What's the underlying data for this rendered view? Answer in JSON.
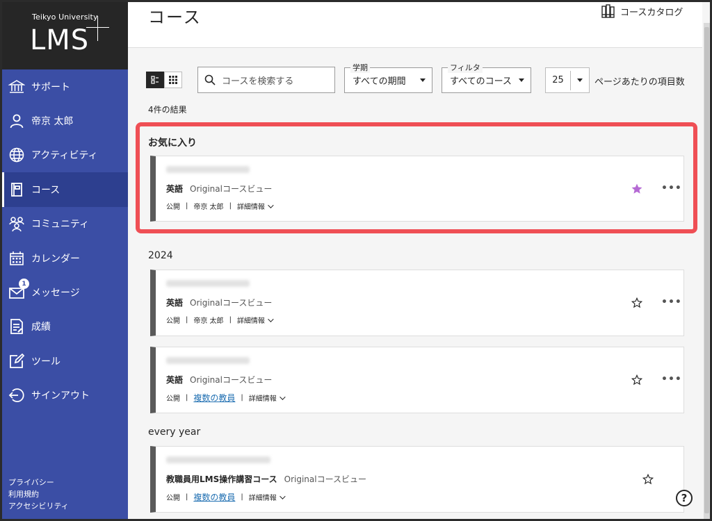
{
  "logo": {
    "university": "Teikyo University",
    "system": "LMS"
  },
  "sidebar": {
    "items": [
      {
        "label": "サポート",
        "icon": "institution-icon"
      },
      {
        "label": "帝京 太郎",
        "icon": "user-icon"
      },
      {
        "label": "アクティビティ",
        "icon": "globe-icon"
      },
      {
        "label": "コース",
        "icon": "book-icon",
        "active": true
      },
      {
        "label": "コミュニティ",
        "icon": "community-icon"
      },
      {
        "label": "カレンダー",
        "icon": "calendar-icon"
      },
      {
        "label": "メッセージ",
        "icon": "envelope-icon",
        "badge": "1"
      },
      {
        "label": "成績",
        "icon": "grades-icon"
      },
      {
        "label": "ツール",
        "icon": "tools-icon"
      },
      {
        "label": "サインアウト",
        "icon": "sign-out-icon"
      }
    ],
    "footer": [
      "プライバシー",
      "利用規約",
      "アクセシビリティ"
    ]
  },
  "header": {
    "title": "コース",
    "catalog_label": "コースカタログ"
  },
  "toolbar": {
    "search_placeholder": "コースを検索する",
    "term_label": "学期",
    "term_value": "すべての期間",
    "filter_label": "フィルタ",
    "filter_value": "すべてのコース",
    "per_page": "25",
    "per_page_label": "ページあたりの項目数"
  },
  "result_count": "4件の結果",
  "sections": [
    {
      "title": "お気に入り"
    },
    {
      "title": "2024"
    },
    {
      "title": "every year"
    }
  ],
  "cards": [
    {
      "name": "英語",
      "view": "Originalコースビュー",
      "status": "公開",
      "instructor": "帝京 太郎",
      "instructor_link": false,
      "details": "詳細情報",
      "favorite": true
    },
    {
      "name": "英語",
      "view": "Originalコースビュー",
      "status": "公開",
      "instructor": "帝京 太郎",
      "instructor_link": false,
      "details": "詳細情報",
      "favorite": false
    },
    {
      "name": "英語",
      "view": "Originalコースビュー",
      "status": "公開",
      "instructor": "複数の教員",
      "instructor_link": true,
      "details": "詳細情報",
      "favorite": false
    },
    {
      "name": "教職員用LMS操作講習コース",
      "view": "Originalコースビュー",
      "status": "公開",
      "instructor": "複数の教員",
      "instructor_link": true,
      "details": "詳細情報",
      "favorite": false
    }
  ],
  "help": "?",
  "colors": {
    "sidebar": "#3b4ea5",
    "highlight": "#ef4f55",
    "favorite_star": "#b56ad4",
    "link": "#1f6fb2"
  }
}
